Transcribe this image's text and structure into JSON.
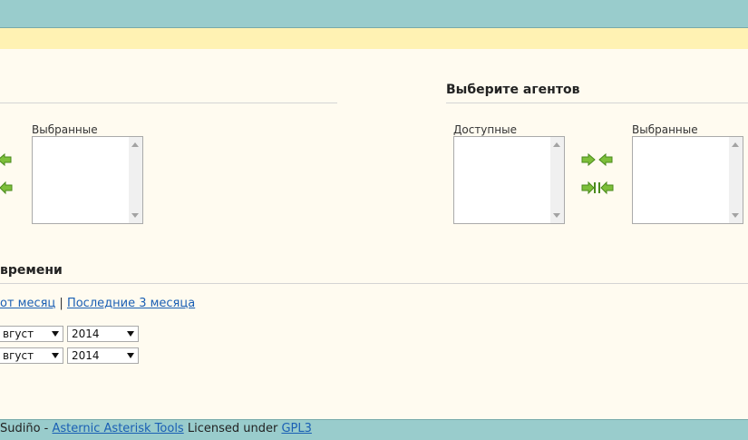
{
  "queues": {
    "selected_label": "Выбранные"
  },
  "agents": {
    "title": "Выберите агентов",
    "available_label": "Доступные",
    "selected_label": "Выбранные"
  },
  "time": {
    "title_fragment": "времени",
    "quick_links": [
      "от месяц",
      "Последние 3 месяца"
    ],
    "separator": "|",
    "start": {
      "month": "вгуст",
      "year": "2014"
    },
    "end": {
      "month": "вгуст",
      "year": "2014"
    }
  },
  "footer": {
    "author_fragment": "Sudiño -",
    "app_link": "Asternic Asterisk Tools",
    "licensed_text": "Licensed under",
    "license_link": "GPL3"
  },
  "colors": {
    "header_bg": "#99cccc",
    "notice_bg": "#fff2b3",
    "page_bg": "#fffbf0",
    "link": "#1a5fb4",
    "arrow_green": "#7dbf3a"
  }
}
